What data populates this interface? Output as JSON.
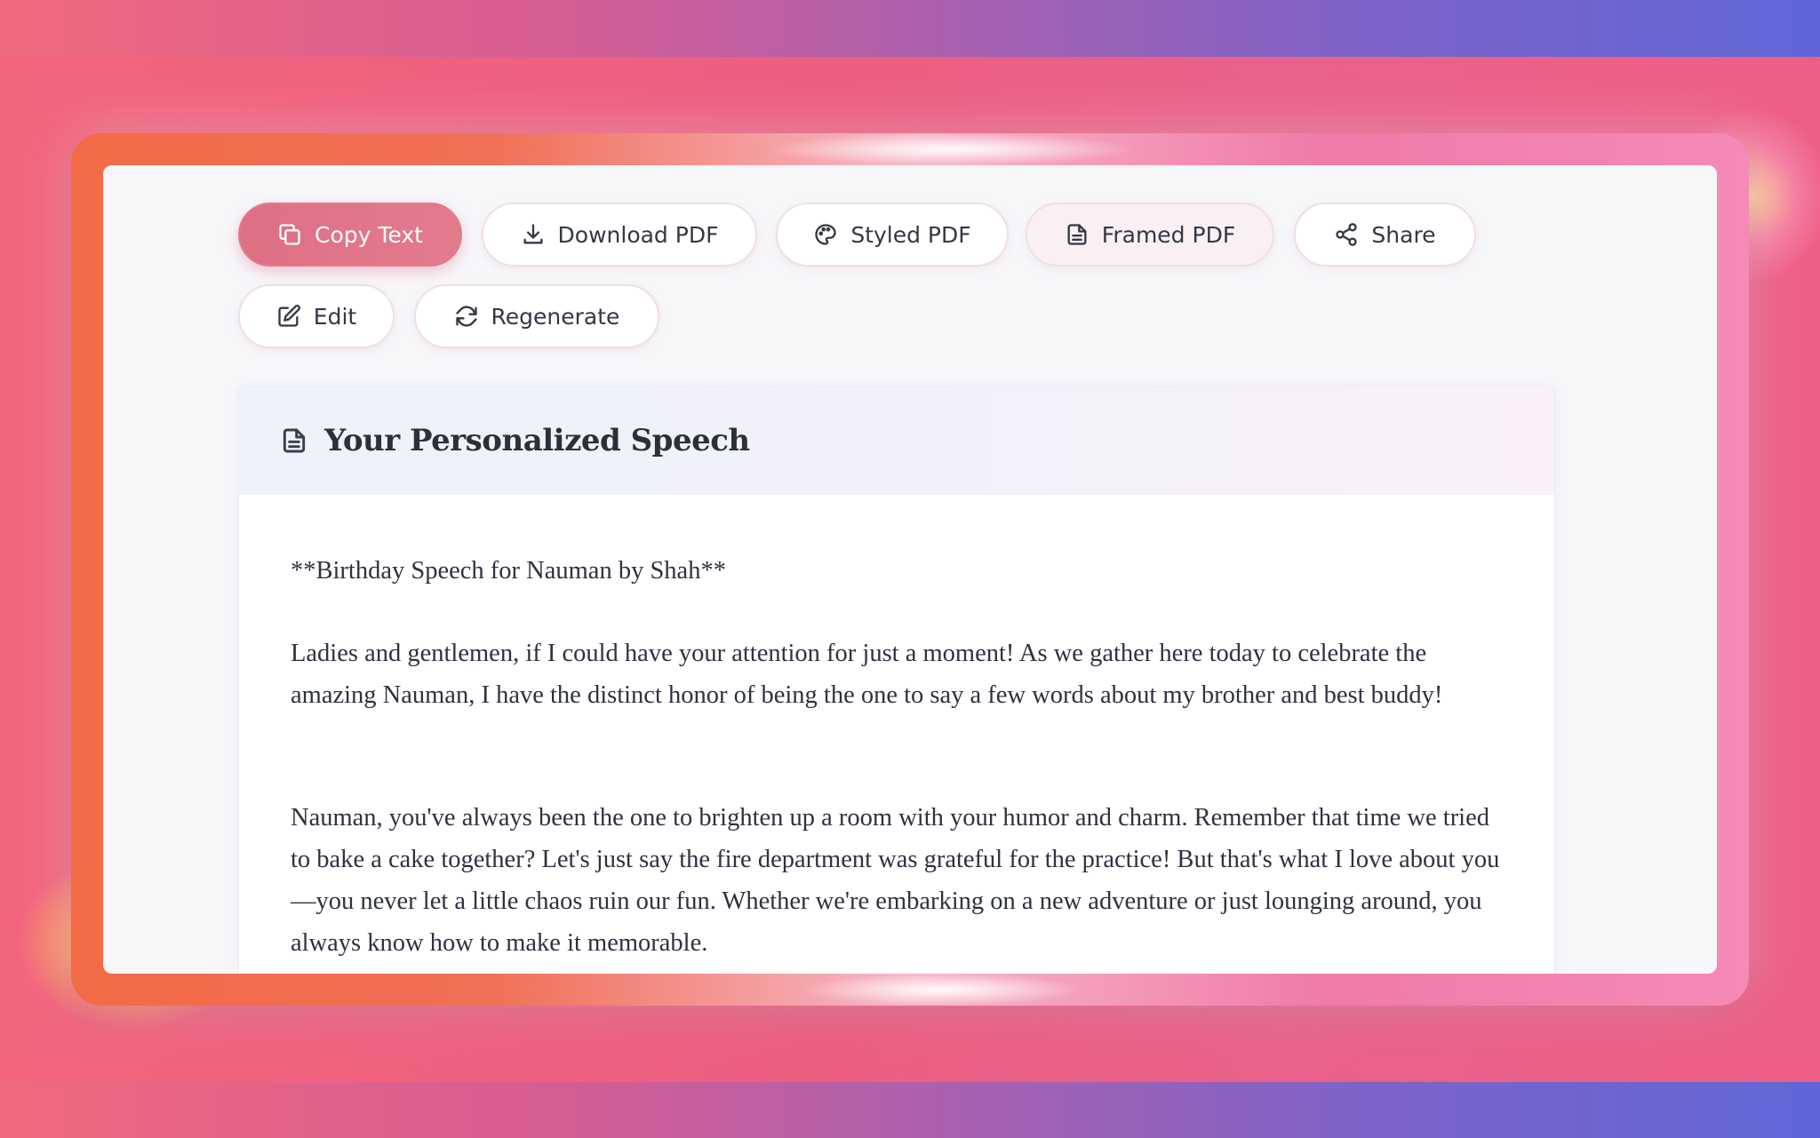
{
  "toolbar": {
    "copy_label": "Copy Text",
    "download_label": "Download PDF",
    "styled_label": "Styled PDF",
    "framed_label": "Framed PDF",
    "share_label": "Share",
    "edit_label": "Edit",
    "regenerate_label": "Regenerate"
  },
  "card": {
    "title": "Your Personalized Speech",
    "paragraphs": [
      "**Birthday Speech for Nauman by Shah**",
      "Ladies and gentlemen, if I could have your attention for just a moment! As we gather here today to celebrate the amazing Nauman, I have the distinct honor of being the one to say a few words about my brother and best buddy!",
      "Nauman, you've always been the one to brighten up a room with your humor and charm. Remember that time we tried to bake a cake together? Let's just say the fire department was grateful for the practice! But that's what I love about you—you never let a little chaos ruin our fun. Whether we're embarking on a new adventure or just lounging around, you always know how to make it memorable."
    ]
  },
  "colors": {
    "accent": "#de6f84",
    "frame_warm": "#f26b45",
    "frame_pink": "#f58ab7",
    "background": "#ec5e80"
  },
  "icons": {
    "copy": "copy-icon",
    "download": "download-icon",
    "styled": "palette-icon",
    "framed": "document-icon",
    "share": "share-icon",
    "edit": "edit-icon",
    "regenerate": "refresh-icon",
    "title": "document-icon"
  }
}
